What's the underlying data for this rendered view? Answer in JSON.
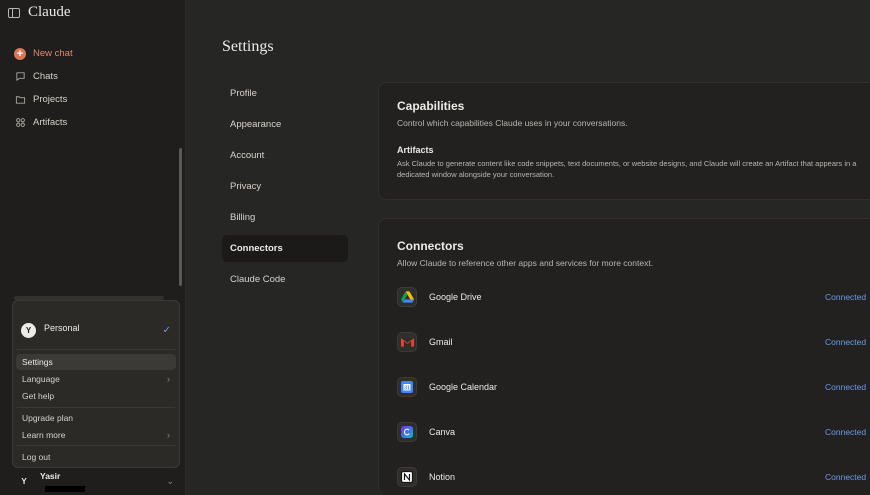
{
  "sidebar": {
    "brand": "Claude",
    "nav": [
      {
        "label": "New chat",
        "icon": "plus-icon"
      },
      {
        "label": "Chats",
        "icon": "chat-icon"
      },
      {
        "label": "Projects",
        "icon": "folder-icon"
      },
      {
        "label": "Artifacts",
        "icon": "artifacts-icon"
      }
    ]
  },
  "menu": {
    "account": {
      "initial": "Y",
      "name": "Personal"
    },
    "items": [
      {
        "label": "Settings"
      },
      {
        "label": "Language"
      },
      {
        "label": "Get help"
      },
      {
        "label": "Upgrade plan"
      },
      {
        "label": "Learn more"
      },
      {
        "label": "Log out"
      }
    ]
  },
  "user": {
    "initial": "Y",
    "name": "Yasir"
  },
  "settings": {
    "title": "Settings",
    "nav": [
      "Profile",
      "Appearance",
      "Account",
      "Privacy",
      "Billing",
      "Connectors",
      "Claude Code"
    ],
    "active": "Connectors"
  },
  "capabilities": {
    "title": "Capabilities",
    "subtitle": "Control which capabilities Claude uses in your conversations.",
    "artifacts_title": "Artifacts",
    "artifacts_desc": "Ask Claude to generate content like code snippets, text documents, or website designs, and Claude will create an Artifact that appears in a dedicated window alongside your conversation."
  },
  "connectors": {
    "title": "Connectors",
    "subtitle": "Allow Claude to reference other apps and services for more context.",
    "items": [
      {
        "name": "Google Drive",
        "status": "Connected",
        "icon": "google-drive-icon"
      },
      {
        "name": "Gmail",
        "status": "Connected",
        "icon": "gmail-icon"
      },
      {
        "name": "Google Calendar",
        "status": "Connected",
        "icon": "google-calendar-icon"
      },
      {
        "name": "Canva",
        "status": "Connected",
        "icon": "canva-icon"
      },
      {
        "name": "Notion",
        "status": "Connected",
        "icon": "notion-icon"
      }
    ]
  },
  "colors": {
    "accent": "#d97757",
    "link": "#6e9ae8",
    "background": "#262624",
    "sidebar": "#1f1e1c"
  }
}
